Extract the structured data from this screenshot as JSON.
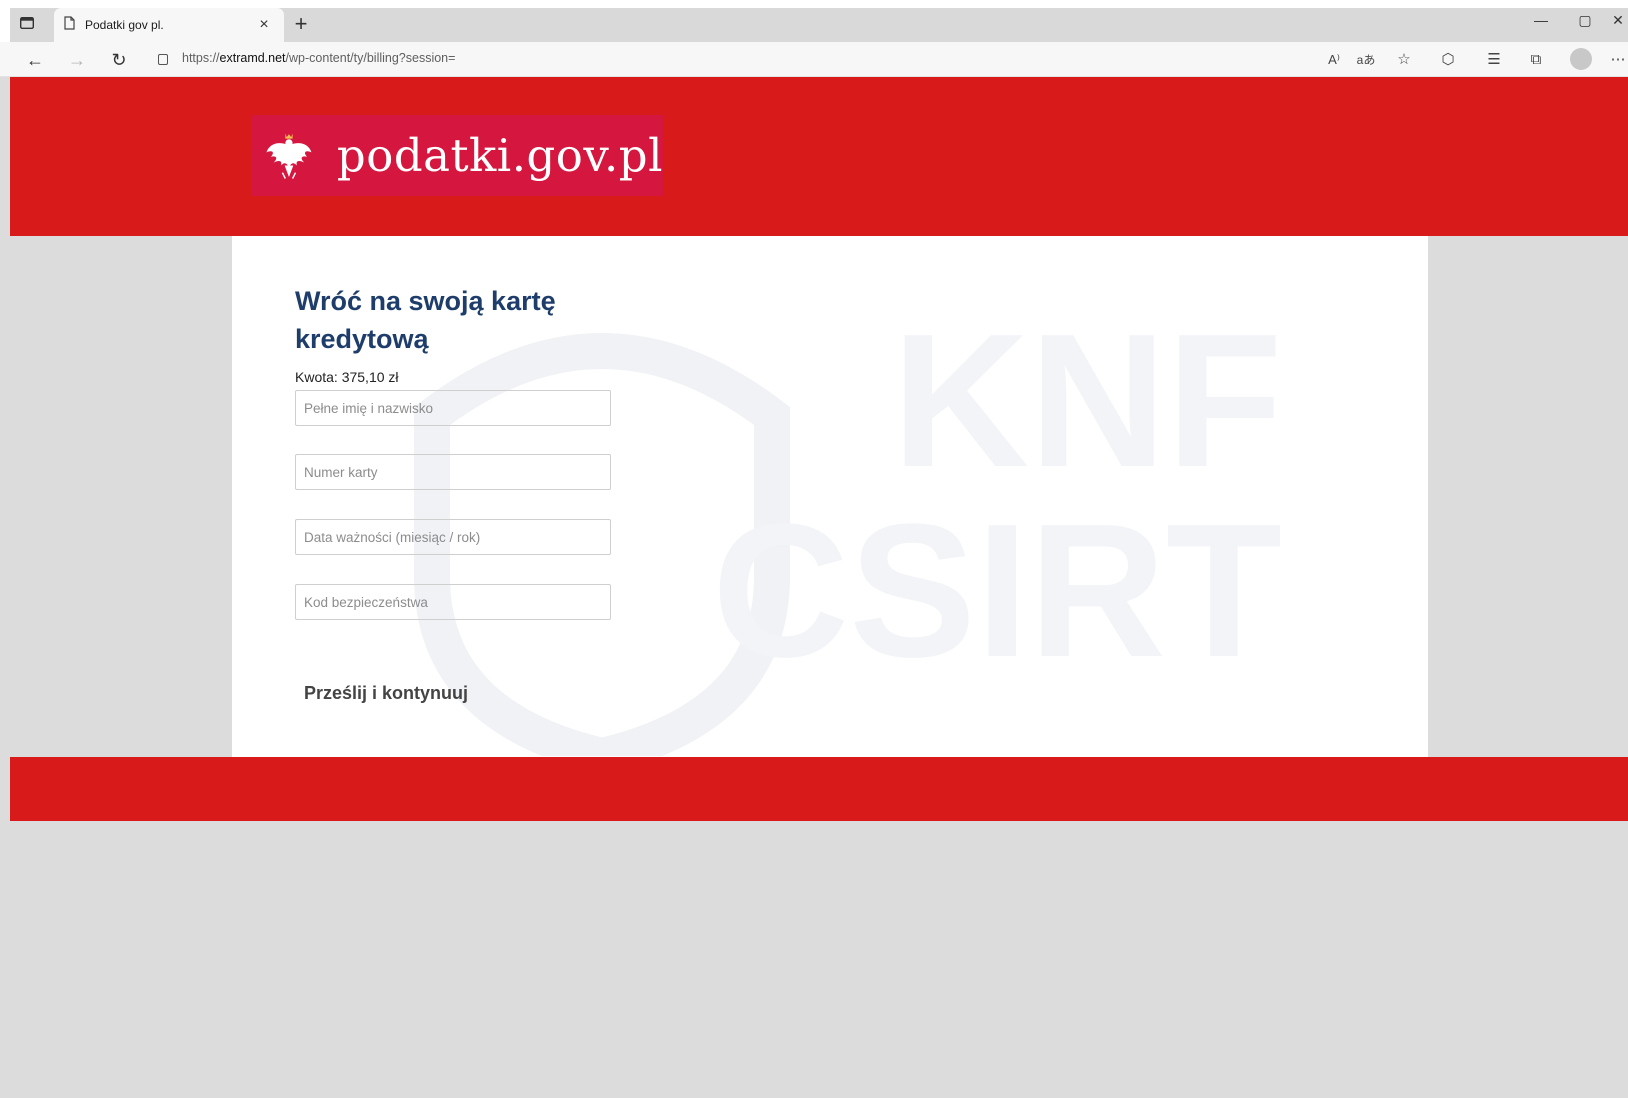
{
  "browser": {
    "tab_title": "Podatki gov pl.",
    "tab_close": "×",
    "new_tab": "+",
    "url_prefix": "https://",
    "url_domain": "extramd.net",
    "url_path": "/wp-content/ty/billing?session=",
    "read_aloud": "A⁾",
    "immersive": "aあ",
    "minimize": "—",
    "maximize": "▢",
    "close": "✕"
  },
  "header": {
    "logo_text": "podatki.gov.pl"
  },
  "form": {
    "title": "Wróć na swoją kartę kredytową",
    "amount": "Kwota: 375,10 zł",
    "fields": [
      {
        "placeholder": "Pełne imię i nazwisko"
      },
      {
        "placeholder": "Numer karty"
      },
      {
        "placeholder": "Data ważności (miesiąc / rok)"
      },
      {
        "placeholder": "Kod bezpieczeństwa"
      }
    ],
    "submit_label": "Prześlij i kontynuuj"
  },
  "watermark": {
    "line1": "KNF",
    "line2": "CSIRT"
  },
  "colors": {
    "header_red": "#d81a1a",
    "logo_bg": "#d5163e",
    "title_blue": "#1e3d6b"
  }
}
